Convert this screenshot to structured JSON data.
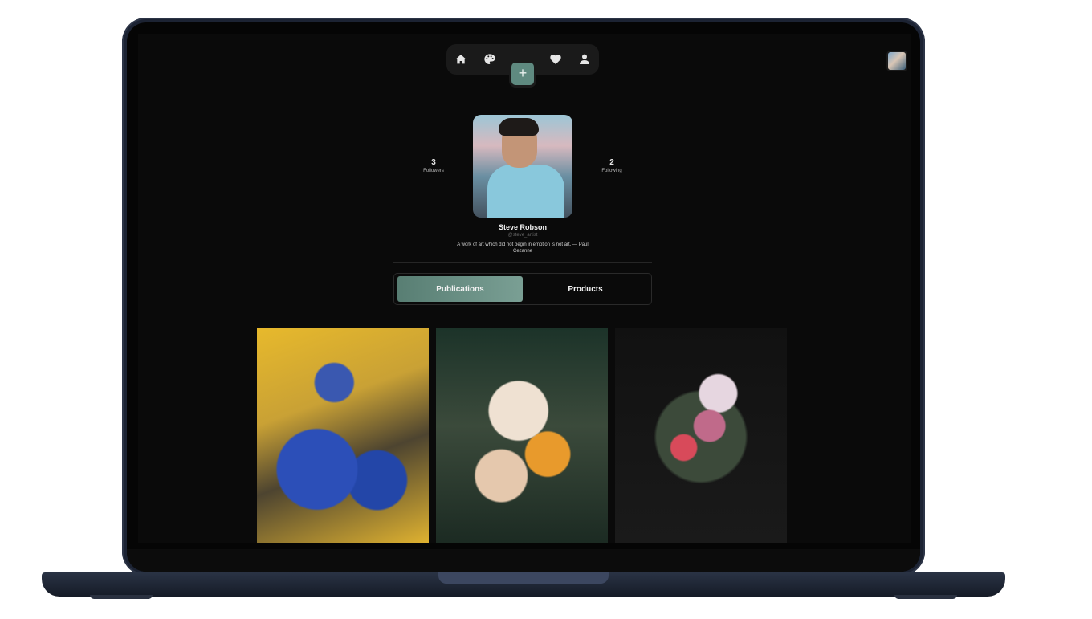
{
  "nav": {
    "items": [
      {
        "name": "home",
        "icon": "home-icon"
      },
      {
        "name": "palette",
        "icon": "palette-icon"
      },
      {
        "name": "favorites",
        "icon": "heart-icon"
      },
      {
        "name": "profile",
        "icon": "user-icon"
      }
    ],
    "add_label": "+"
  },
  "profile": {
    "followers_count": "3",
    "followers_label": "Followers",
    "following_count": "2",
    "following_label": "Following",
    "name": "Steve Robson",
    "handle": "@steve_artist",
    "bio": "A work of art which did not begin in emotion is not art. — Paul Cezanne"
  },
  "tabs": {
    "publications": "Publications",
    "products": "Products",
    "active": "Publications"
  },
  "gallery": {
    "items": [
      {
        "name": "blue-and-yellow-flowers-painting"
      },
      {
        "name": "pale-flowers-collage"
      },
      {
        "name": "dark-bouquet-painting"
      }
    ]
  },
  "colors": {
    "accent": "#5f8a80",
    "background": "#0a0a0a",
    "text": "#f2f2f2"
  }
}
